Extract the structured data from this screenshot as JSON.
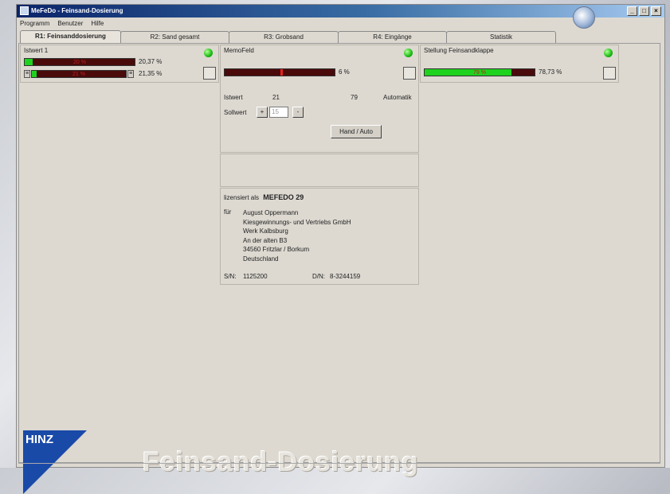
{
  "window": {
    "title": "MeFeDo - Feinsand-Dosierung",
    "controls": [
      "_",
      "□",
      "×"
    ]
  },
  "menu": [
    {
      "label": "Programm"
    },
    {
      "label": "Benutzer"
    },
    {
      "label": "Hilfe"
    }
  ],
  "tabs": [
    {
      "label": "R1: Feinsanddosierung",
      "active": true
    },
    {
      "label": "R2: Sand gesamt"
    },
    {
      "label": "R3: Grobsand"
    },
    {
      "label": "R4: Eingänge"
    },
    {
      "label": "Statistik"
    }
  ],
  "istwert_panel": {
    "title": "Istwert 1",
    "bar1": {
      "value_label": "20 %",
      "pct_text": "20,37 %",
      "fill": 0.07
    },
    "bar2": {
      "value_label": "21 %",
      "pct_text": "21,35 %",
      "fill": 0.05
    }
  },
  "memo_panel": {
    "title": "MemoFeld",
    "bar": {
      "pct_text": "6 %",
      "marker": 0.51
    },
    "istwert_label": "Istwert",
    "istwert_value": "21",
    "value2": "79",
    "mode": "Automatik",
    "sollwert_label": "Sollwert",
    "sollwert_value": "15",
    "plus_label": "+",
    "minus_label": "-",
    "hand_auto_button": "Hand / Auto"
  },
  "stellung_panel": {
    "title": "Stellung Feinsandklappe",
    "bar": {
      "value_label": "79 %",
      "pct_text": "78,73 %",
      "fill": 0.79
    }
  },
  "license": {
    "line": "lizensiert als",
    "product": "MEFEDO 29",
    "fuer_label": "für",
    "address": [
      "August Oppermann",
      "Kiesgewinnungs- und Vertriebs GmbH",
      "Werk Kalbsburg",
      "An der alten B3",
      "34560 Fritzlar / Borkum",
      "Deutschland"
    ],
    "sn_label": "S/N:",
    "sn_value": "1125200",
    "dn_label": "D/N:",
    "dn_value": "8-3244159"
  },
  "branding": {
    "logo_text": "HINZ",
    "app_title": "Feinsand-Dosierung"
  },
  "colors": {
    "led": "#22c21a",
    "bar_bg": "#4a0a0a",
    "bar_fill": "#1ed21e",
    "marker": "#e82020",
    "logo": "#1a4aa8"
  }
}
